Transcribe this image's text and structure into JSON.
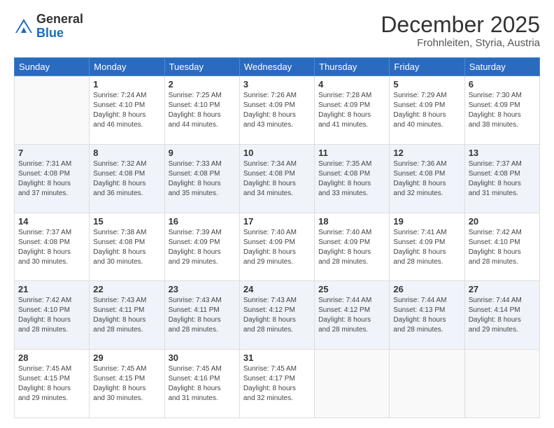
{
  "header": {
    "logo_general": "General",
    "logo_blue": "Blue",
    "month_title": "December 2025",
    "subtitle": "Frohnleiten, Styria, Austria"
  },
  "days_of_week": [
    "Sunday",
    "Monday",
    "Tuesday",
    "Wednesday",
    "Thursday",
    "Friday",
    "Saturday"
  ],
  "weeks": [
    [
      {
        "day": "",
        "info": ""
      },
      {
        "day": "1",
        "info": "Sunrise: 7:24 AM\nSunset: 4:10 PM\nDaylight: 8 hours\nand 46 minutes."
      },
      {
        "day": "2",
        "info": "Sunrise: 7:25 AM\nSunset: 4:10 PM\nDaylight: 8 hours\nand 44 minutes."
      },
      {
        "day": "3",
        "info": "Sunrise: 7:26 AM\nSunset: 4:09 PM\nDaylight: 8 hours\nand 43 minutes."
      },
      {
        "day": "4",
        "info": "Sunrise: 7:28 AM\nSunset: 4:09 PM\nDaylight: 8 hours\nand 41 minutes."
      },
      {
        "day": "5",
        "info": "Sunrise: 7:29 AM\nSunset: 4:09 PM\nDaylight: 8 hours\nand 40 minutes."
      },
      {
        "day": "6",
        "info": "Sunrise: 7:30 AM\nSunset: 4:09 PM\nDaylight: 8 hours\nand 38 minutes."
      }
    ],
    [
      {
        "day": "7",
        "info": "Sunrise: 7:31 AM\nSunset: 4:08 PM\nDaylight: 8 hours\nand 37 minutes."
      },
      {
        "day": "8",
        "info": "Sunrise: 7:32 AM\nSunset: 4:08 PM\nDaylight: 8 hours\nand 36 minutes."
      },
      {
        "day": "9",
        "info": "Sunrise: 7:33 AM\nSunset: 4:08 PM\nDaylight: 8 hours\nand 35 minutes."
      },
      {
        "day": "10",
        "info": "Sunrise: 7:34 AM\nSunset: 4:08 PM\nDaylight: 8 hours\nand 34 minutes."
      },
      {
        "day": "11",
        "info": "Sunrise: 7:35 AM\nSunset: 4:08 PM\nDaylight: 8 hours\nand 33 minutes."
      },
      {
        "day": "12",
        "info": "Sunrise: 7:36 AM\nSunset: 4:08 PM\nDaylight: 8 hours\nand 32 minutes."
      },
      {
        "day": "13",
        "info": "Sunrise: 7:37 AM\nSunset: 4:08 PM\nDaylight: 8 hours\nand 31 minutes."
      }
    ],
    [
      {
        "day": "14",
        "info": "Sunrise: 7:37 AM\nSunset: 4:08 PM\nDaylight: 8 hours\nand 30 minutes."
      },
      {
        "day": "15",
        "info": "Sunrise: 7:38 AM\nSunset: 4:08 PM\nDaylight: 8 hours\nand 30 minutes."
      },
      {
        "day": "16",
        "info": "Sunrise: 7:39 AM\nSunset: 4:09 PM\nDaylight: 8 hours\nand 29 minutes."
      },
      {
        "day": "17",
        "info": "Sunrise: 7:40 AM\nSunset: 4:09 PM\nDaylight: 8 hours\nand 29 minutes."
      },
      {
        "day": "18",
        "info": "Sunrise: 7:40 AM\nSunset: 4:09 PM\nDaylight: 8 hours\nand 28 minutes."
      },
      {
        "day": "19",
        "info": "Sunrise: 7:41 AM\nSunset: 4:09 PM\nDaylight: 8 hours\nand 28 minutes."
      },
      {
        "day": "20",
        "info": "Sunrise: 7:42 AM\nSunset: 4:10 PM\nDaylight: 8 hours\nand 28 minutes."
      }
    ],
    [
      {
        "day": "21",
        "info": "Sunrise: 7:42 AM\nSunset: 4:10 PM\nDaylight: 8 hours\nand 28 minutes."
      },
      {
        "day": "22",
        "info": "Sunrise: 7:43 AM\nSunset: 4:11 PM\nDaylight: 8 hours\nand 28 minutes."
      },
      {
        "day": "23",
        "info": "Sunrise: 7:43 AM\nSunset: 4:11 PM\nDaylight: 8 hours\nand 28 minutes."
      },
      {
        "day": "24",
        "info": "Sunrise: 7:43 AM\nSunset: 4:12 PM\nDaylight: 8 hours\nand 28 minutes."
      },
      {
        "day": "25",
        "info": "Sunrise: 7:44 AM\nSunset: 4:12 PM\nDaylight: 8 hours\nand 28 minutes."
      },
      {
        "day": "26",
        "info": "Sunrise: 7:44 AM\nSunset: 4:13 PM\nDaylight: 8 hours\nand 28 minutes."
      },
      {
        "day": "27",
        "info": "Sunrise: 7:44 AM\nSunset: 4:14 PM\nDaylight: 8 hours\nand 29 minutes."
      }
    ],
    [
      {
        "day": "28",
        "info": "Sunrise: 7:45 AM\nSunset: 4:15 PM\nDaylight: 8 hours\nand 29 minutes."
      },
      {
        "day": "29",
        "info": "Sunrise: 7:45 AM\nSunset: 4:15 PM\nDaylight: 8 hours\nand 30 minutes."
      },
      {
        "day": "30",
        "info": "Sunrise: 7:45 AM\nSunset: 4:16 PM\nDaylight: 8 hours\nand 31 minutes."
      },
      {
        "day": "31",
        "info": "Sunrise: 7:45 AM\nSunset: 4:17 PM\nDaylight: 8 hours\nand 32 minutes."
      },
      {
        "day": "",
        "info": ""
      },
      {
        "day": "",
        "info": ""
      },
      {
        "day": "",
        "info": ""
      }
    ]
  ]
}
